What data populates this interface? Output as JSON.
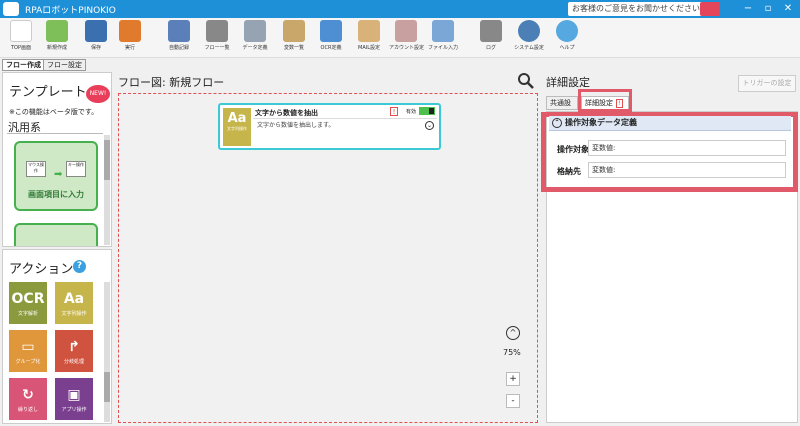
{
  "window": {
    "title": "RPAロボットPINOKIO",
    "feedback": "お客様のご意見をお聞かせください",
    "minimize": "−",
    "maximize": "▫",
    "close": "✕"
  },
  "toolbar": {
    "top": "TOP画面",
    "new": "新規作成",
    "save": "保存",
    "run": "実行",
    "record": "自動記録",
    "flow_list": "フロー一覧",
    "data": "データ定義",
    "variable": "変数一覧",
    "ocr": "OCR定義",
    "mail": "MAIL設定",
    "account": "アカウント設定",
    "file_input": "ファイル入力",
    "log": "ログ",
    "system": "システム設定",
    "help": "ヘルプ"
  },
  "left_tabs": [
    "フロー作成",
    "フロー設定"
  ],
  "templates": {
    "title": "テンプレート",
    "new_badge": "NEW!",
    "note": "※この機能はベータ版です。",
    "category": "汎用系",
    "card1": {
      "caption": "画面項目に入力",
      "from": "マウス操作",
      "to": "キー操作"
    }
  },
  "actions": {
    "title": "アクション",
    "help": "?",
    "items": [
      {
        "label": "文字解析",
        "glyph": "OCR",
        "color": "#8a9a3c"
      },
      {
        "label": "文字列操作",
        "glyph": "Aa",
        "color": "#c6b54b"
      },
      {
        "label": "グループ化",
        "glyph": "▭",
        "color": "#e0963a"
      },
      {
        "label": "分岐処理",
        "glyph": "↱",
        "color": "#d0533f"
      },
      {
        "label": "繰り返し",
        "glyph": "↻",
        "color": "#d95577"
      },
      {
        "label": "アプリ操作",
        "glyph": "▣",
        "color": "#7a3f8e"
      }
    ]
  },
  "flow": {
    "title": "フロー図:  新規フロー",
    "node": {
      "icon_text": "Aa",
      "icon_sub": "文字列操作",
      "name": "文字から数値を抽出",
      "description": "文字から数値を抽出します。",
      "status_label": "有効",
      "warn": "!"
    },
    "zoom_up": "^",
    "zoom_level": "75%",
    "zoom_in": "+",
    "zoom_out": "-"
  },
  "detail": {
    "title": "詳細設定",
    "trigger_button": "トリガーの設定",
    "tab_common": "共通設定",
    "tab_detail": "詳細設定",
    "tab_warn": "!",
    "section_title": "操作対象データ定義",
    "fields": [
      {
        "label": "操作対象",
        "value": "変数値:"
      },
      {
        "label": "格納先",
        "value": "変数値:"
      }
    ]
  }
}
